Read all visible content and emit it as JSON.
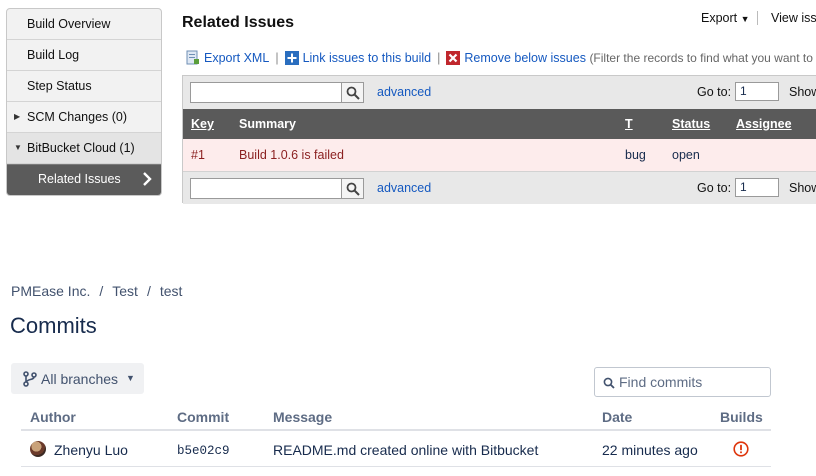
{
  "sidebar": {
    "items": [
      {
        "label": "Build Overview"
      },
      {
        "label": "Build Log"
      },
      {
        "label": "Step Status"
      },
      {
        "label": "SCM Changes (0)"
      },
      {
        "label": "BitBucket Cloud (1)"
      },
      {
        "label": "Related Issues"
      }
    ]
  },
  "issues": {
    "title": "Related Issues",
    "export_label": "Export",
    "view_label": "View issu",
    "ops": {
      "export_xml": "Export XML",
      "link_issues": "Link issues to this build",
      "remove_issues": "Remove below issues",
      "hint": "(Filter the records to find what you want to remo"
    },
    "filter": {
      "advanced": "advanced",
      "goto_label": "Go to:",
      "page_value": "1",
      "show_label": "Show"
    },
    "columns": [
      "Key",
      "Summary",
      "T",
      "Status",
      "Assignee"
    ],
    "rows": [
      {
        "key": "#1",
        "summary": "Build 1.0.6 is failed",
        "type": "bug",
        "status": "open",
        "assignee": ""
      }
    ]
  },
  "bitbucket": {
    "breadcrumb": [
      "PMEase Inc.",
      "Test",
      "test"
    ],
    "title": "Commits",
    "branch_label": "All branches",
    "find_placeholder": "Find commits",
    "columns": [
      "Author",
      "Commit",
      "Message",
      "Date",
      "Builds"
    ],
    "commits": [
      {
        "author": "Zhenyu Luo",
        "hash": "b5e02c9",
        "message": "README.md created online with Bitbucket",
        "date": "22 minutes ago"
      }
    ],
    "colors": {
      "link": "#1559c0",
      "error": "#de350b",
      "header": "#5a5a5a",
      "row_highlight": "#fdecec"
    }
  }
}
